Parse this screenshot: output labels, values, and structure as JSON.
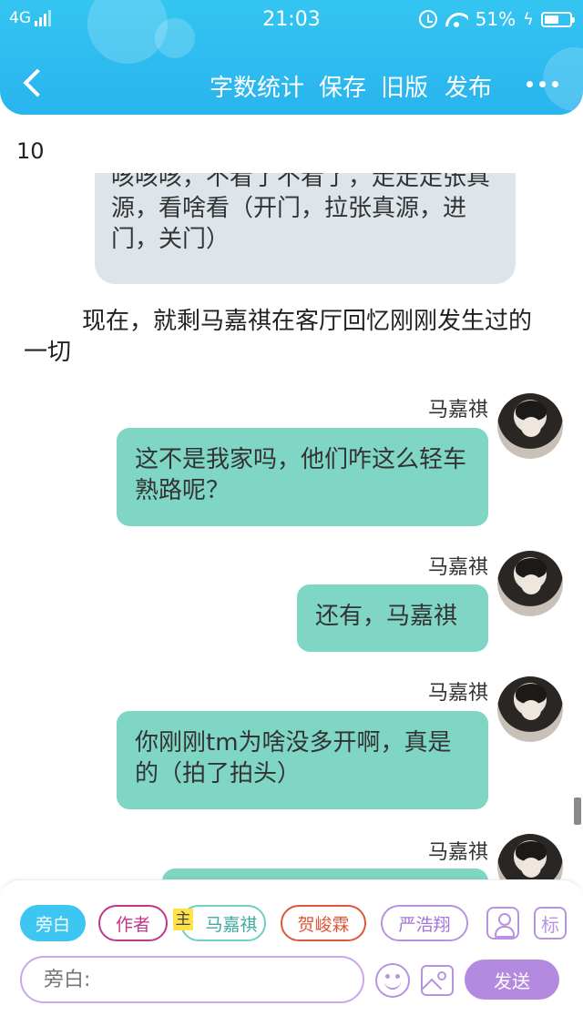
{
  "status_bar": {
    "network": "4G",
    "time": "21:03",
    "battery": "51%"
  },
  "toolbar": {
    "items": [
      "字数统计",
      "保存",
      "旧版",
      "发布"
    ]
  },
  "content": {
    "word_count": "10",
    "partial_bubble_text": "咳咳咳，不看了不看了，走走走张真源，看啥看（开门，拉张真源，进门，关门）",
    "narration": "现在，就剩马嘉祺在客厅回忆刚刚发生过的一切",
    "messages": [
      {
        "name": "马嘉祺",
        "text": "这不是我家吗，他们咋这么轻车熟路呢？"
      },
      {
        "name": "马嘉祺",
        "text": "还有，马嘉祺"
      },
      {
        "name": "马嘉祺",
        "text": "你刚刚tm为啥没多开啊，真是的（拍了拍头）"
      },
      {
        "name": "马嘉祺",
        "text": ""
      }
    ]
  },
  "roles": {
    "narrator": "旁白",
    "author": "作者",
    "main_badge": "主",
    "main_role": "马嘉祺",
    "role2": "贺峻霖",
    "role3": "严浩翔",
    "mark_label": "标"
  },
  "composer": {
    "placeholder": "旁白:",
    "send_label": "发送"
  },
  "colors": {
    "header": "#29b4ee",
    "teal_bubble": "#7fd6c5",
    "gray_bubble": "#dde5ea",
    "accent_purple": "#b489e0"
  }
}
